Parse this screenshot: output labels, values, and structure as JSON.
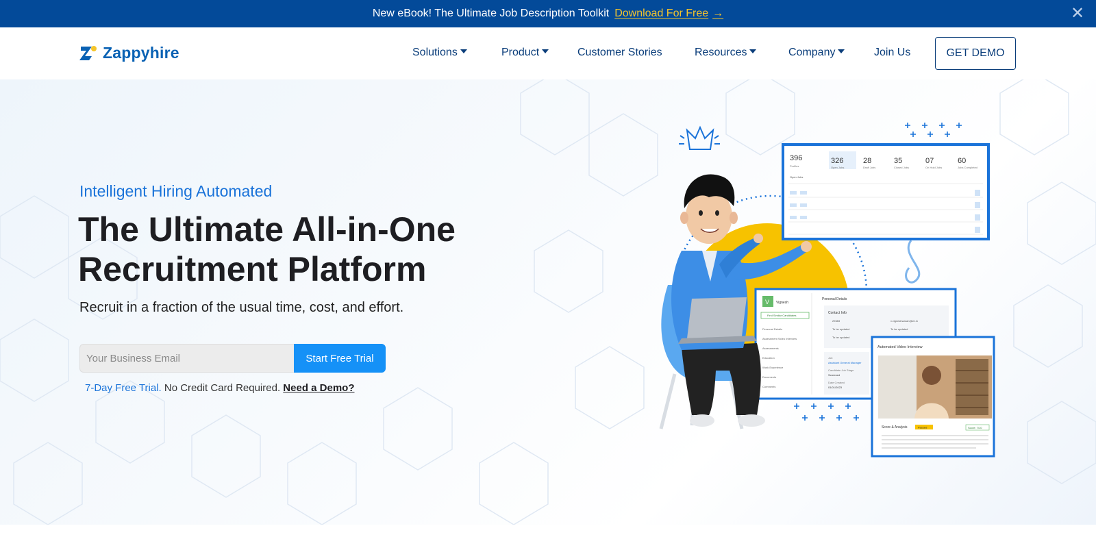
{
  "announcement": {
    "message": "New eBook! The Ultimate Job Description Toolkit",
    "cta": "Download For Free",
    "cta_icon": "arrow-right-icon",
    "close_icon": "close-icon"
  },
  "brand": {
    "name": "Zappyhire",
    "logo_icon": "zappyhire-logo-icon",
    "primary_color": "#034a99",
    "accent_color": "#1591f7",
    "cta_yellow": "#f5c52b"
  },
  "nav": {
    "items": [
      {
        "label": "Solutions",
        "dropdown": true
      },
      {
        "label": "Product",
        "dropdown": true
      },
      {
        "label": "Customer Stories",
        "dropdown": false
      },
      {
        "label": "Resources",
        "dropdown": true
      },
      {
        "label": "Company",
        "dropdown": true
      },
      {
        "label": "Join Us",
        "dropdown": false
      }
    ],
    "demo_button": "GET DEMO"
  },
  "hero": {
    "eyebrow": "Intelligent Hiring Automated",
    "headline_line1": "The Ultimate All-in-One",
    "headline_line2": "Recruitment Platform",
    "subline": "Recruit in a fraction of the usual time, cost, and effort.",
    "email_placeholder": "Your Business Email",
    "email_value": "",
    "trial_button": "Start Free Trial",
    "note_blue": "7-Day Free Trial.",
    "note_text": "No Credit Card Required.",
    "note_link": "Need a Demo?"
  },
  "illustration": {
    "dashboard_stats": [
      {
        "value": "396",
        "label": "Profiles"
      },
      {
        "value": "326",
        "label": "Open Jobs"
      },
      {
        "value": "28",
        "label": "Draft Jobs"
      },
      {
        "value": "35",
        "label": "Closed Jobs"
      },
      {
        "value": "07",
        "label": "On Hold Jobs"
      },
      {
        "value": "60",
        "label": "Jobs Completed"
      }
    ],
    "dashboard_filter": "Open Jobs",
    "profile_panel": {
      "candidate_name": "Vignesh",
      "avatar_letter": "V",
      "find_button": "Find Similar Candidates",
      "sidebar_items": [
        "Personal Details",
        "Assessment Video Interview",
        "Assessments",
        "Education",
        "Work Experience",
        "Documents",
        "Comments"
      ],
      "section_title": "Personal Details",
      "contact_title": "Contact Info",
      "contact_phone": "29383",
      "contact_email": "v.vigneshwaran@zh.in",
      "to_be_updated": "To be updated",
      "job_label": "Job",
      "job_value": "Assistant General Manager",
      "stage_label": "Candidate Job Stage",
      "stage_value": "Screened",
      "date_label": "Date Created",
      "date_value": "01/01/2023"
    },
    "video_panel": {
      "title": "Automated Video Interview",
      "score_title": "Score & Analysis",
      "score_badge": "Passed",
      "score_value": "Score: 7/10",
      "analysis": "The answer is mostly accurate and provides a good explanation of what pointers are in C. However, the candidate could have gone into more detail about how pointers are used and the syntax of declaring and using pointers. Additionally, the candidate could have provided more examples of how pointers are used in C."
    }
  }
}
